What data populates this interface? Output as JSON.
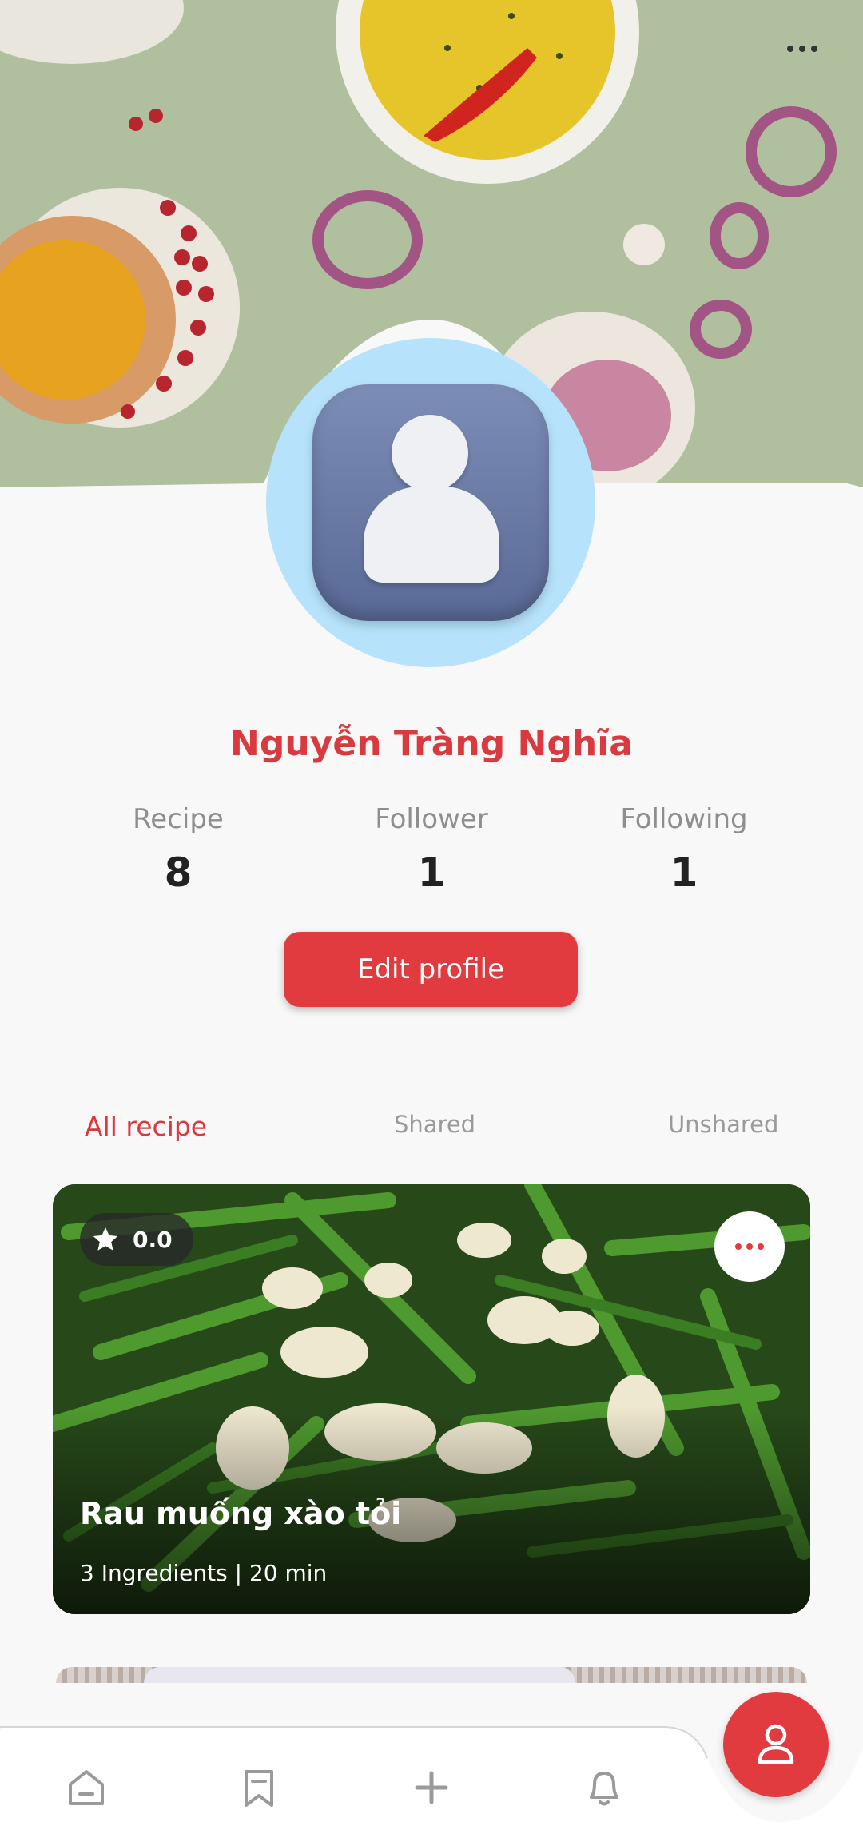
{
  "profile": {
    "name": "Nguyễn Tràng Nghĩa",
    "stats": [
      {
        "label": "Recipe",
        "value": "8"
      },
      {
        "label": "Follower",
        "value": "1"
      },
      {
        "label": "Following",
        "value": "1"
      }
    ],
    "edit_label": "Edit profile"
  },
  "tabs": [
    {
      "label": "All recipe",
      "active": true
    },
    {
      "label": "Shared",
      "active": false
    },
    {
      "label": "Unshared",
      "active": false
    }
  ],
  "recipes": [
    {
      "title": "Rau muống xào tỏi",
      "meta": "3 Ingredients | 20 min",
      "rating": "0.0"
    }
  ],
  "nav": {
    "items": [
      {
        "icon": "home-icon"
      },
      {
        "icon": "bookmark-icon"
      },
      {
        "icon": "plus-icon"
      },
      {
        "icon": "bell-icon"
      }
    ],
    "active": "profile-icon"
  },
  "colors": {
    "accent": "#e23b3f",
    "name": "#d93a3f",
    "avatar_ring": "#b6e3fb"
  }
}
